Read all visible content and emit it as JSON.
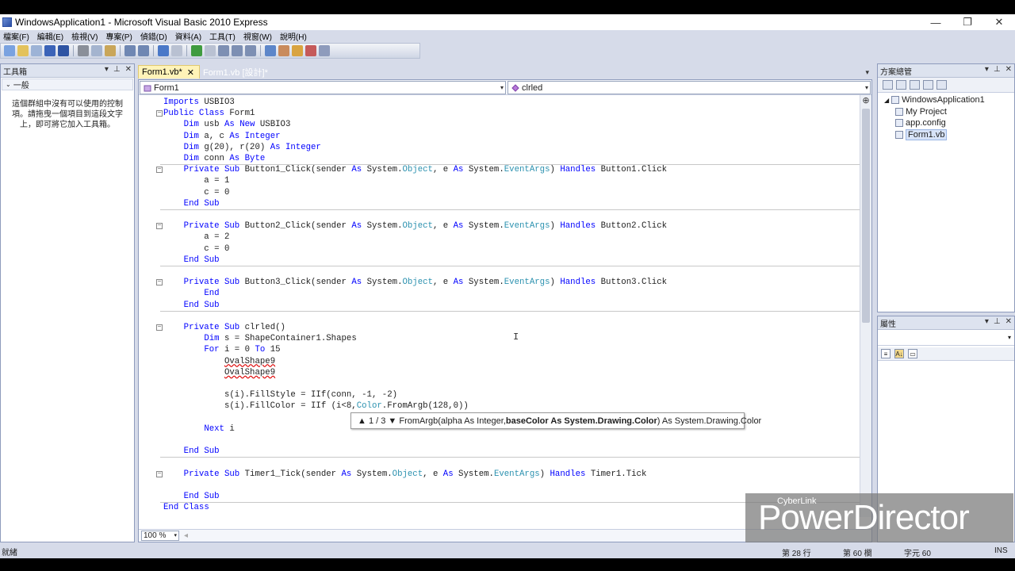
{
  "window": {
    "title": "WindowsApplication1 - Microsoft Visual Basic 2010 Express",
    "controls": [
      "—",
      "❐",
      "✕"
    ]
  },
  "menu": [
    "檔案(F)",
    "編輯(E)",
    "檢視(V)",
    "專案(P)",
    "偵錯(D)",
    "資料(A)",
    "工具(T)",
    "視窗(W)",
    "說明(H)"
  ],
  "toolbox": {
    "title": "工具箱",
    "group": "一般",
    "message": "這個群組中沒有可以使用的控制項。請拖曳一個項目到這段文字上，即可將它加入工具箱。"
  },
  "tabs": [
    {
      "label": "Form1.vb*",
      "active": true
    },
    {
      "label": "Form1.vb [設計]*",
      "active": false
    }
  ],
  "editor": {
    "object_combo": "Form1",
    "member_combo": "clrled",
    "zoom": "100 %",
    "code": [
      "Imports USBIO3",
      "Public Class Form1",
      "    Dim usb As New USBIO3",
      "    Dim a, c As Integer",
      "    Dim g(20), r(20) As Integer",
      "    Dim conn As Byte",
      "    Private Sub Button1_Click(sender As System.Object, e As System.EventArgs) Handles Button1.Click",
      "        a = 1",
      "        c = 0",
      "    End Sub",
      "",
      "    Private Sub Button2_Click(sender As System.Object, e As System.EventArgs) Handles Button2.Click",
      "        a = 2",
      "        c = 0",
      "    End Sub",
      "",
      "    Private Sub Button3_Click(sender As System.Object, e As System.EventArgs) Handles Button3.Click",
      "        End",
      "    End Sub",
      "",
      "    Private Sub clrled()",
      "        Dim s = ShapeContainer1.Shapes",
      "        For i = 0 To 15",
      "            OvalShape9",
      "            OvalShape9",
      "",
      "            s(i).FillStyle = IIf(conn, -1, -2)",
      "            s(i).FillColor = IIf (i<8,Color.FromArgb(128,0))",
      "",
      "        Next i",
      "",
      "    End Sub",
      "",
      "    Private Sub Timer1_Tick(sender As System.Object, e As System.EventArgs) Handles Timer1.Tick",
      "",
      "    End Sub",
      "End Class"
    ],
    "tooltip": {
      "counter": "▲ 1 / 3 ▼",
      "sig_start": "FromArgb(alpha As Integer, ",
      "sig_bold": "baseColor As System.Drawing.Color",
      "sig_end": ") As System.Drawing.Color"
    }
  },
  "solution_explorer": {
    "title": "方案總管",
    "items": [
      "WindowsApplication1",
      "My Project",
      "app.config",
      "Form1.vb"
    ]
  },
  "properties": {
    "title": "屬性"
  },
  "status": {
    "ready": "就緒",
    "line": "第 28 行",
    "col": "第 60 欄",
    "char": "字元 60",
    "mode": "INS"
  },
  "watermark": {
    "small": "CyberLink",
    "big": "PowerDirector"
  },
  "colors": {
    "keyword": "#0000ff",
    "type": "#2b91af",
    "tab_active": "#fff3b8",
    "chrome": "#d6dbe9"
  }
}
